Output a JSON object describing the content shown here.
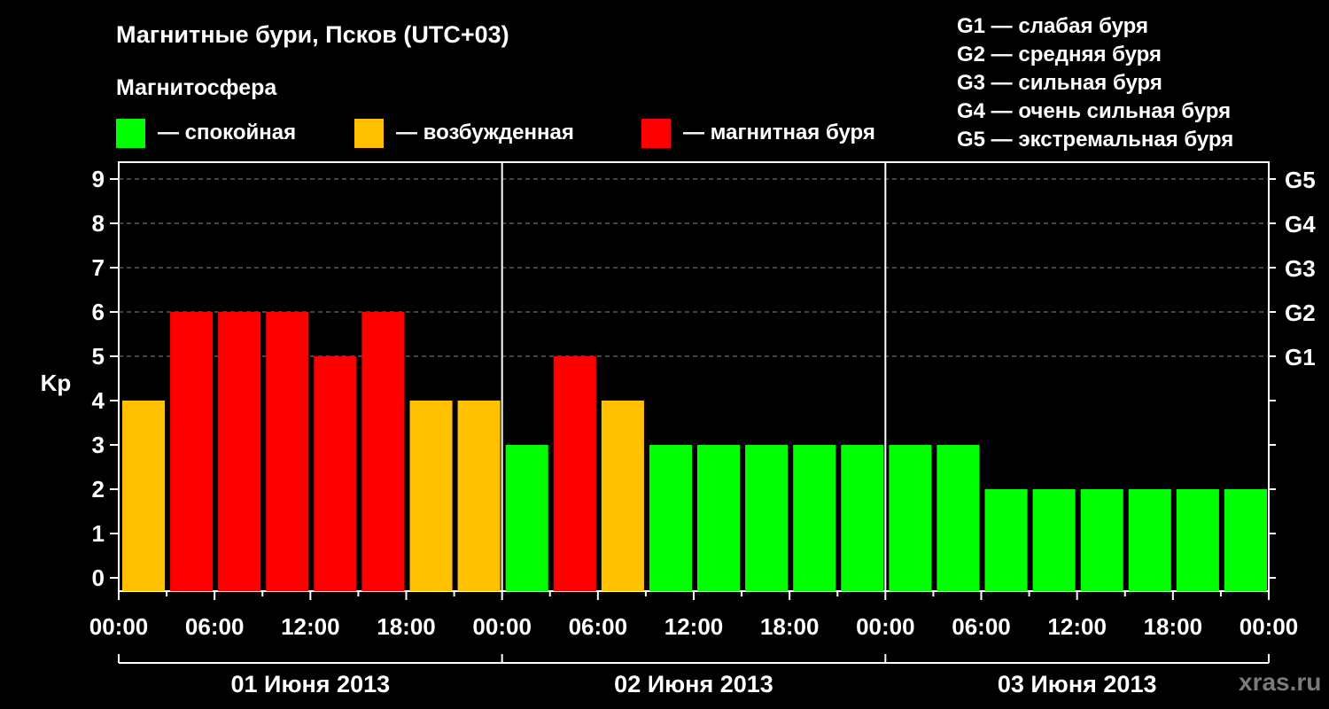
{
  "title": "Магнитные бури, Псков (UTC+03)",
  "subtitle": "Магнитосфера",
  "legend": [
    {
      "label": "— спокойная",
      "color": "#00ff00"
    },
    {
      "label": "— возбужденная",
      "color": "#ffc000"
    },
    {
      "label": "— магнитная буря",
      "color": "#ff0000"
    }
  ],
  "storm_levels": [
    "G1 — слабая буря",
    "G2 — средняя буря",
    "G3 — сильная буря",
    "G4 — очень сильная буря",
    "G5 — экстремальная буря"
  ],
  "watermark": "xras.ru",
  "chart_data": {
    "type": "bar",
    "ylabel": "Kp",
    "ylim": [
      0,
      9
    ],
    "y_ticks": [
      "0",
      "1",
      "2",
      "3",
      "4",
      "5",
      "6",
      "7",
      "8",
      "9"
    ],
    "right_axis_labels": [
      {
        "value": 5,
        "label": "G1"
      },
      {
        "value": 6,
        "label": "G2"
      },
      {
        "value": 7,
        "label": "G3"
      },
      {
        "value": 8,
        "label": "G4"
      },
      {
        "value": 9,
        "label": "G5"
      }
    ],
    "x_tick_labels": [
      "00:00",
      "06:00",
      "12:00",
      "18:00",
      "00:00",
      "06:00",
      "12:00",
      "18:00",
      "00:00",
      "06:00",
      "12:00",
      "18:00",
      "00:00"
    ],
    "days": [
      "01 Июня 2013",
      "02 Июня 2013",
      "03 Июня 2013"
    ],
    "grid": "dashed horizontal at 5-9",
    "values": [
      4,
      6,
      6,
      6,
      5,
      6,
      4,
      4,
      3,
      5,
      4,
      3,
      3,
      3,
      3,
      3,
      3,
      3,
      2,
      2,
      2,
      2,
      2,
      2
    ],
    "colors": [
      "#ffc000",
      "#ff0000",
      "#ff0000",
      "#ff0000",
      "#ff0000",
      "#ff0000",
      "#ffc000",
      "#ffc000",
      "#00ff00",
      "#ff0000",
      "#ffc000",
      "#00ff00",
      "#00ff00",
      "#00ff00",
      "#00ff00",
      "#00ff00",
      "#00ff00",
      "#00ff00",
      "#00ff00",
      "#00ff00",
      "#00ff00",
      "#00ff00",
      "#00ff00",
      "#00ff00"
    ]
  }
}
